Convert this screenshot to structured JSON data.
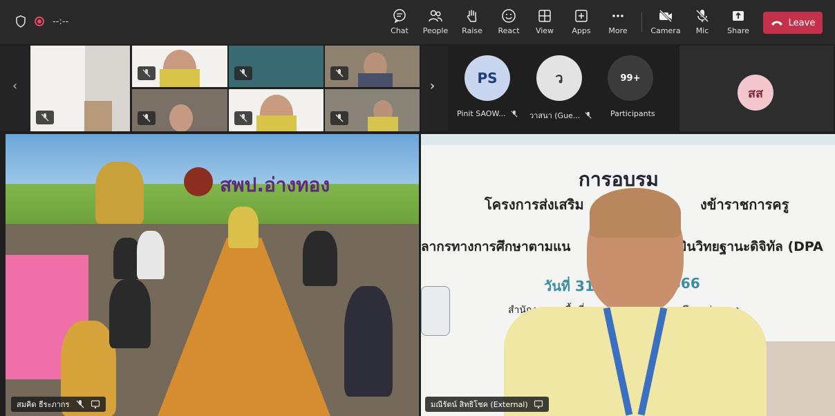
{
  "topbar": {
    "timer": "--:--",
    "buttons": [
      {
        "id": "chat",
        "label": "Chat"
      },
      {
        "id": "people",
        "label": "People"
      },
      {
        "id": "raise",
        "label": "Raise"
      },
      {
        "id": "react",
        "label": "React"
      },
      {
        "id": "view",
        "label": "View"
      },
      {
        "id": "apps",
        "label": "Apps"
      },
      {
        "id": "more",
        "label": "More"
      },
      {
        "id": "camera",
        "label": "Camera"
      },
      {
        "id": "mic",
        "label": "Mic"
      },
      {
        "id": "share",
        "label": "Share"
      }
    ],
    "leave_label": "Leave",
    "colors": {
      "leave": "#c4314b",
      "bar": "#292929"
    }
  },
  "participants": {
    "p1": {
      "initials": "PS",
      "name": "Pinit SAOW...",
      "color": "#c9d6ef",
      "text_color": "#1f3d7a"
    },
    "p2": {
      "initials": "ว",
      "name": "วาสนา (Gue...",
      "color": "#e3e3e3",
      "text_color": "#333333"
    },
    "p3": {
      "initials": "99+",
      "name": "Participants",
      "color": "#3b3b3b",
      "text_color": "#ffffff"
    },
    "p4": {
      "initials": "สส",
      "color": "#f4c7cf",
      "text_color": "#7a2b3a"
    }
  },
  "main_left": {
    "name": "สมคิด ธีระภากร",
    "banner": "สพป.อ่างทอง"
  },
  "main_right": {
    "name": "มณีรัตน์ สิทธิโชค (External)",
    "slide": {
      "title": "การอบรม",
      "line1": "โครงการส่งเสริม",
      "line1b": "งข้าราชการครู",
      "line2": "ลากรทางการศึกษาตามแน",
      "line2b": "มินวิทยฐานะดิจิทัล (DPA",
      "date_a": "วันที่ 31",
      "date_b": "566",
      "office_a": "สำนักงานเขตพื้นที่",
      "office_b": "ศึกษาอ่างทอง"
    }
  }
}
